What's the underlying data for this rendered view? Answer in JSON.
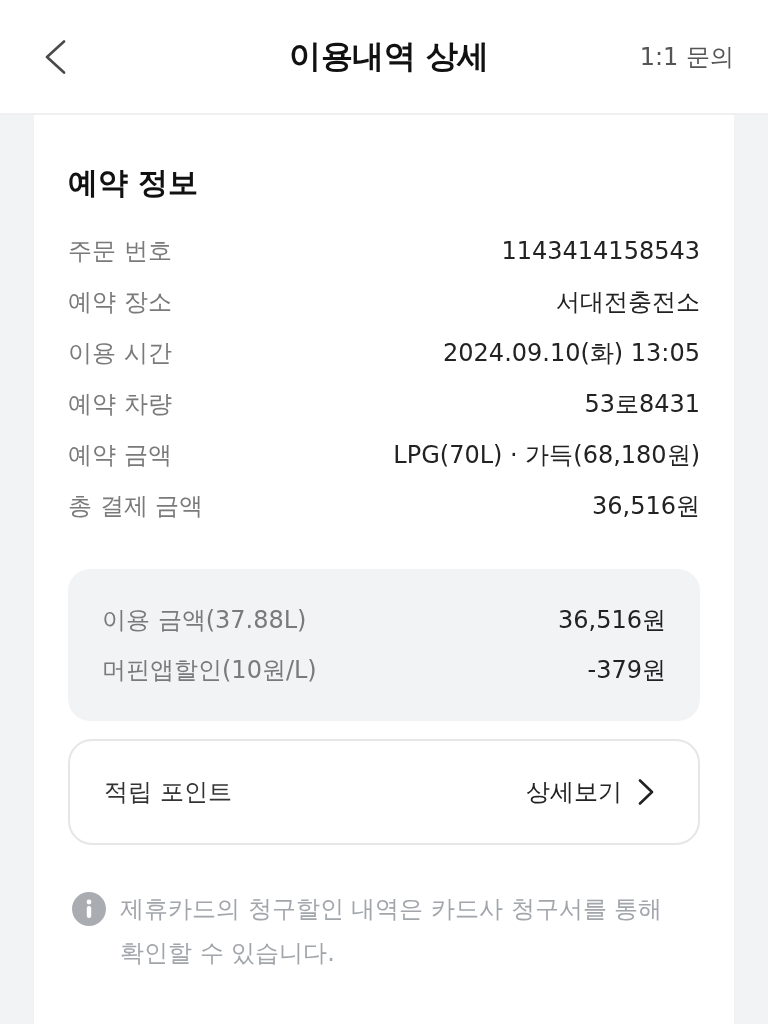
{
  "header": {
    "title": "이용내역 상세",
    "action": "1:1 문의"
  },
  "reservation": {
    "title": "예약 정보",
    "rows": [
      {
        "label": "주문 번호",
        "value": "1143414158543"
      },
      {
        "label": "예약 장소",
        "value": "서대전충전소"
      },
      {
        "label": "이용 시간",
        "value": "2024.09.10(화) 13:05"
      },
      {
        "label": "예약 차량",
        "value": "53로8431"
      },
      {
        "label": "예약 금액",
        "value": "LPG(70L) · 가득(68,180원)"
      },
      {
        "label": "총 결제 금액",
        "value": "36,516원"
      }
    ]
  },
  "usage_summary": {
    "rows": [
      {
        "label": "이용 금액(37.88L)",
        "value": "36,516원"
      },
      {
        "label": "머핀앱할인(10원/L)",
        "value": "-379원"
      }
    ]
  },
  "points": {
    "label": "적립 포인트",
    "link": "상세보기"
  },
  "notice": {
    "text": "제휴카드의 청구할인 내역은 카드사 청구서를 통해 확인할 수 있습니다."
  }
}
